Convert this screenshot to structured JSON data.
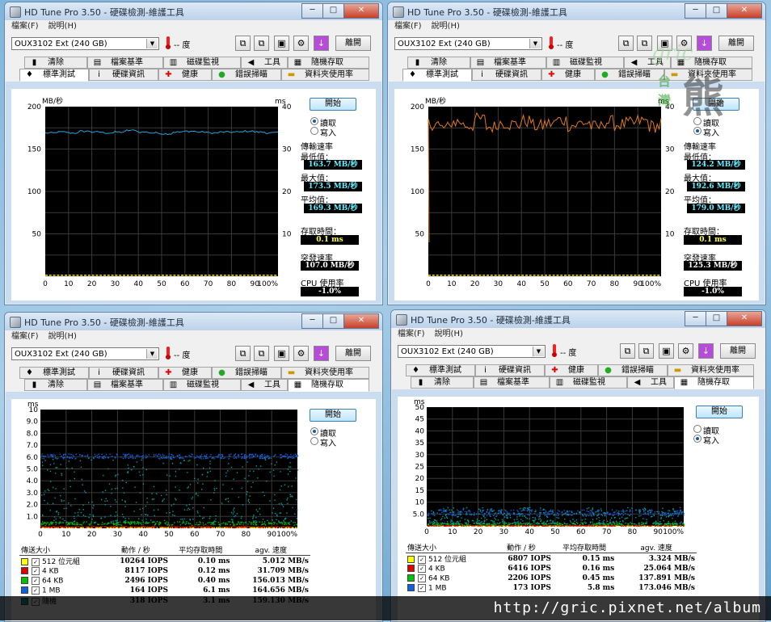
{
  "app_title": "HD Tune Pro 3.50 - 硬碟檢測-維護工具",
  "menu": [
    "檔案(F)",
    "說明(H)"
  ],
  "drive": "OUX3102 Ext (240 GB)",
  "temperature": "-- 度",
  "exit_label": "離開",
  "start_label": "開始",
  "read_label": "讀取",
  "write_label": "寫入",
  "tabs": {
    "benchmark": "標準測試",
    "info": "硬碟資訊",
    "health": "健康",
    "error_scan": "錯誤掃瞄",
    "folder_usage": "資料夾使用率",
    "erase": "清除",
    "file_benchmark": "檔案基準",
    "disk_monitor": "磁碟監視",
    "tools": "工具",
    "random_access": "隨機存取"
  },
  "labels": {
    "transfer_rate": "傳輸速率",
    "minimum": "最低值：",
    "maximum": "最大值：",
    "average": "平均值：",
    "access_time": "存取時間：",
    "burst_rate": "突發速率",
    "cpu_usage": "CPU 使用率",
    "col_size": "傳送大小",
    "col_ops": "動作 / 秒",
    "col_avg_access": "平均存取時間",
    "col_avg_speed": "agv. 速度"
  },
  "units": {
    "mbs": "MB/秒",
    "ms": "ms",
    "pct": "100%"
  },
  "benchmark_read": {
    "min": "163.7 MB/秒",
    "max": "173.5 MB/秒",
    "avg": "169.3 MB/秒",
    "access": "0.1 ms",
    "burst": "107.0 MB/秒",
    "cpu": "-1.0%"
  },
  "benchmark_write": {
    "min": "124.2 MB/秒",
    "max": "192.6 MB/秒",
    "avg": "179.0 MB/秒",
    "access": "0.1 ms",
    "burst": "125.3 MB/秒",
    "cpu": "-1.0%"
  },
  "random_read": [
    {
      "size": "512 位元組",
      "color": "#ffff00",
      "ops": "10264 IOPS",
      "time": "0.10 ms",
      "speed": "5.012 MB/s"
    },
    {
      "size": "4 KB",
      "color": "#e00000",
      "ops": "8117 IOPS",
      "time": "0.12 ms",
      "speed": "31.709 MB/s"
    },
    {
      "size": "64 KB",
      "color": "#00c000",
      "ops": "2496 IOPS",
      "time": "0.40 ms",
      "speed": "156.013 MB/s"
    },
    {
      "size": "1 MB",
      "color": "#1060e0",
      "ops": "164 IOPS",
      "time": "6.1 ms",
      "speed": "164.656 MB/s"
    },
    {
      "size": "隨機",
      "color": "#00a0a0",
      "ops": "318 IOPS",
      "time": "3.1 ms",
      "speed": "159.130 MB/s"
    }
  ],
  "random_write": [
    {
      "size": "512 位元組",
      "color": "#ffff00",
      "ops": "6807 IOPS",
      "time": "0.15 ms",
      "speed": "3.324 MB/s"
    },
    {
      "size": "4 KB",
      "color": "#e00000",
      "ops": "6416 IOPS",
      "time": "0.16 ms",
      "speed": "25.064 MB/s"
    },
    {
      "size": "64 KB",
      "color": "#00c000",
      "ops": "2206 IOPS",
      "time": "0.45 ms",
      "speed": "137.891 MB/s"
    },
    {
      "size": "1 MB",
      "color": "#1060e0",
      "ops": "173 IOPS",
      "time": "5.8 ms",
      "speed": "173.046 MB/s"
    }
  ],
  "chart_data": [
    {
      "type": "line",
      "panel": "benchmark-read",
      "xlabel": "",
      "x_ticks": [
        "0",
        "10",
        "20",
        "30",
        "40",
        "50",
        "60",
        "70",
        "80",
        "90",
        "100%"
      ],
      "y_left_ticks": [
        "200",
        "150",
        "100",
        "50"
      ],
      "y_right_ticks": [
        "40",
        "30",
        "20",
        "10"
      ],
      "ylabel": "MB/秒",
      "y2label": "ms",
      "ylim": [
        0,
        200
      ],
      "y2lim": [
        0,
        40
      ],
      "series": [
        {
          "color": "#2ba3d8",
          "values": [
            169,
            170,
            169,
            171,
            170,
            169,
            170,
            172,
            170,
            169,
            168,
            170,
            171,
            170,
            169,
            170,
            170,
            171,
            170,
            169,
            170
          ]
        }
      ]
    },
    {
      "type": "line",
      "panel": "benchmark-write",
      "xlabel": "",
      "x_ticks": [
        "0",
        "10",
        "20",
        "30",
        "40",
        "50",
        "60",
        "70",
        "80",
        "90",
        "100%"
      ],
      "y_left_ticks": [
        "200",
        "150",
        "100",
        "50"
      ],
      "y_right_ticks": [
        "40",
        "30",
        "20",
        "10"
      ],
      "ylabel": "MB/秒",
      "y2label": "ms",
      "ylim": [
        0,
        200
      ],
      "y2lim": [
        0,
        40
      ],
      "series": [
        {
          "color": "#e07a1a",
          "values": [
            180,
            175,
            182,
            178,
            185,
            176,
            181,
            179,
            183,
            177,
            180,
            184,
            178,
            181,
            176,
            182,
            179,
            180,
            183,
            177,
            181
          ]
        }
      ]
    },
    {
      "type": "scatter",
      "panel": "random-read",
      "ylabel": "ms",
      "ylim": [
        0,
        10
      ],
      "x_ticks": [
        "0",
        "10",
        "20",
        "30",
        "40",
        "50",
        "60",
        "70",
        "80",
        "90",
        "100%"
      ],
      "y_ticks": [
        "10",
        "9.0",
        "8.0",
        "7.0",
        "6.0",
        "5.0",
        "4.0",
        "3.0",
        "2.0",
        "1.0"
      ],
      "series": [
        {
          "color": "#ffff00",
          "band": [
            0.1,
            0.1
          ]
        },
        {
          "color": "#e00000",
          "band": [
            0.12,
            0.2
          ]
        },
        {
          "color": "#00c000",
          "band": [
            0.3,
            0.6
          ]
        },
        {
          "color": "#1060e0",
          "band": [
            5.9,
            6.3
          ]
        },
        {
          "color": "#00a0a0",
          "band": [
            0.5,
            6.0
          ]
        }
      ]
    },
    {
      "type": "scatter",
      "panel": "random-write",
      "ylabel": "ms",
      "ylim": [
        0,
        50
      ],
      "x_ticks": [
        "0",
        "10",
        "20",
        "30",
        "40",
        "50",
        "60",
        "70",
        "80",
        "90",
        "100%"
      ],
      "y_ticks": [
        "50",
        "45",
        "40",
        "35",
        "30",
        "25",
        "20",
        "15",
        "10",
        "5.0"
      ],
      "series": [
        {
          "color": "#ffff00",
          "band": [
            0.15,
            0.15
          ]
        },
        {
          "color": "#e00000",
          "band": [
            0.16,
            0.3
          ]
        },
        {
          "color": "#00c000",
          "band": [
            0.4,
            1.5
          ]
        },
        {
          "color": "#1060e0",
          "band": [
            4.5,
            7.0
          ]
        },
        {
          "color": "#00a0a0",
          "band": [
            1.0,
            8.0
          ]
        }
      ]
    }
  ],
  "watermark": "http://gric.pixnet.net/album",
  "logo_text": [
    "gric",
    "台",
    "灣",
    "熊"
  ]
}
